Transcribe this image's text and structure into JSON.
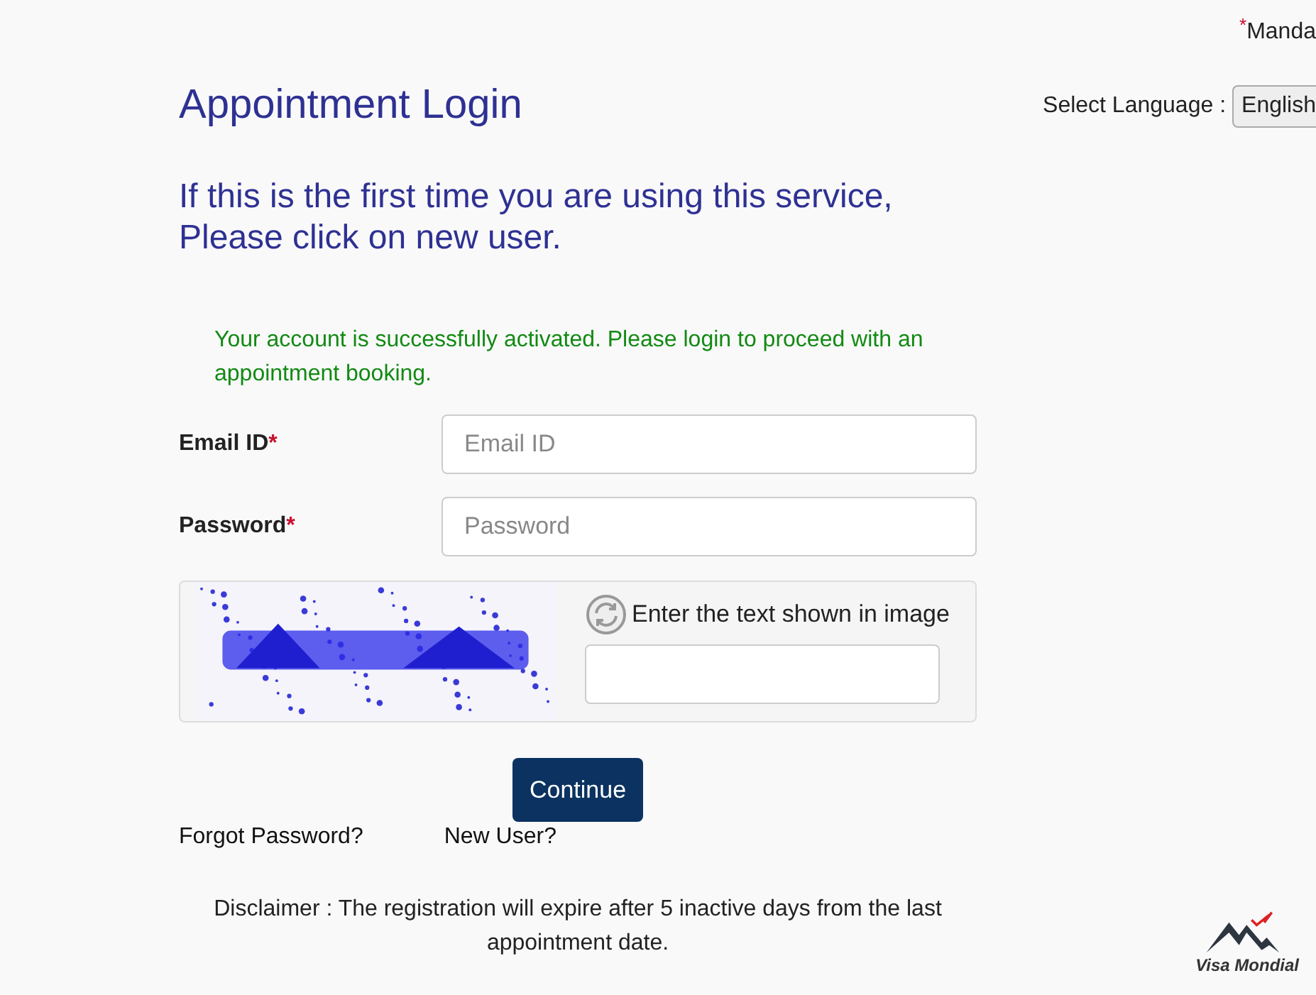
{
  "mandatory_note": {
    "mark": "*",
    "text": "Manda"
  },
  "language": {
    "label": "Select Language :",
    "value": "English"
  },
  "title": "Appointment Login",
  "intro": [
    "If this is the first time you are using this service,",
    "Please click on new user."
  ],
  "success_message": "Your account is successfully activated. Please login to proceed with an appointment booking.",
  "fields": [
    {
      "label": "Email ID",
      "required_mark": "*",
      "placeholder": "Email ID"
    },
    {
      "label": "Password",
      "required_mark": "*",
      "placeholder": "Password"
    }
  ],
  "captcha": {
    "kind": "picture",
    "prompt": "Enter the text shown in image"
  },
  "continue_button": "Continue",
  "links": [
    "Forgot Password?",
    "New User?"
  ],
  "disclaimer": "Disclaimer : The registration will expire after 5 inactive days from the last appointment date.",
  "logo": {
    "name": "Visa Mondial"
  }
}
